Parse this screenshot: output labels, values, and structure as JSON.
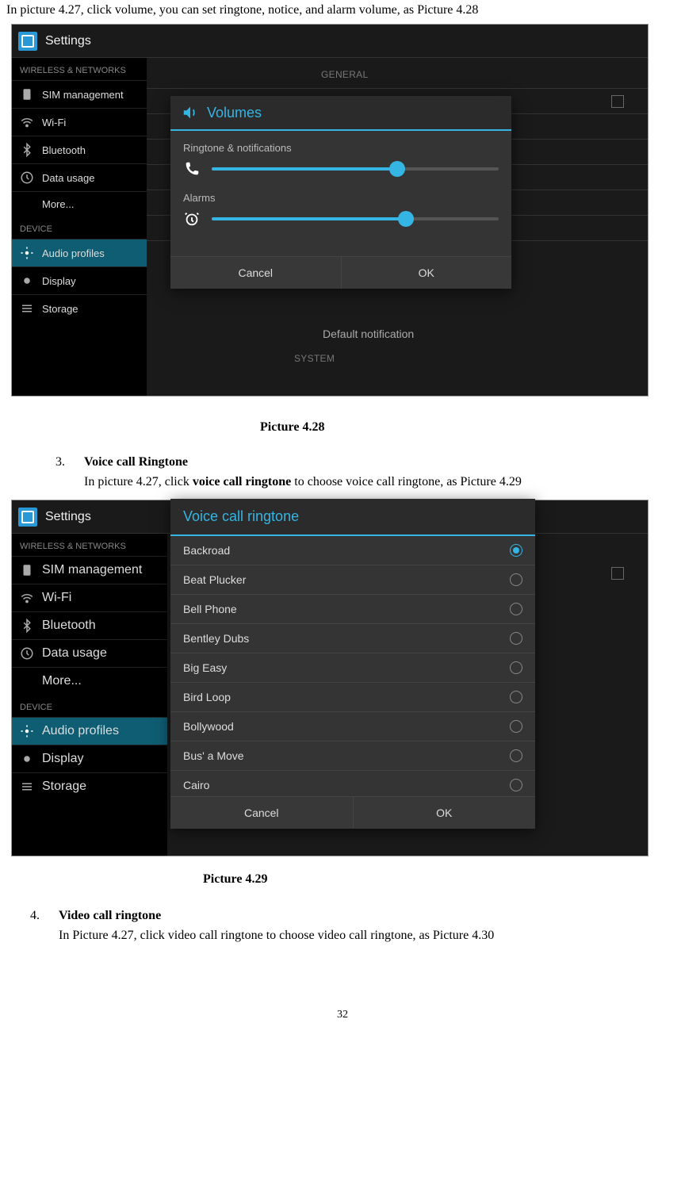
{
  "intro_text": "In picture 4.27, click volume, you can set ringtone, notice, and alarm volume, as Picture 4.28",
  "pic428": {
    "header_title": "Settings",
    "section_wireless": "WIRELESS & NETWORKS",
    "items_wireless": [
      "SIM management",
      "Wi-Fi",
      "Bluetooth",
      "Data usage",
      "More..."
    ],
    "section_device": "DEVICE",
    "items_device": [
      "Audio profiles",
      "Display",
      "Storage"
    ],
    "right_general": "GENERAL",
    "right_default_notification": "Default notification",
    "right_system": "SYSTEM",
    "dialog": {
      "title": "Volumes",
      "label_ringtone": "Ringtone & notifications",
      "label_alarms": "Alarms",
      "cancel": "Cancel",
      "ok": "OK"
    },
    "caption": "Picture 4.28"
  },
  "sec3": {
    "num": "3.",
    "head": "Voice call Ringtone",
    "para_a": "In picture 4.27, click ",
    "para_bold": "voice call ringtone",
    "para_b": " to choose voice call ringtone, as Picture 4.29"
  },
  "pic429": {
    "header_title": "Settings",
    "section_wireless": "WIRELESS & NETWORKS",
    "items_wireless": [
      "SIM management",
      "Wi-Fi",
      "Bluetooth",
      "Data usage",
      "More..."
    ],
    "section_device": "DEVICE",
    "items_device": [
      "Audio profiles",
      "Display",
      "Storage"
    ],
    "dialog": {
      "title": "Voice call ringtone",
      "options": [
        "Backroad",
        "Beat Plucker",
        "Bell Phone",
        "Bentley Dubs",
        "Big Easy",
        "Bird Loop",
        "Bollywood",
        "Bus' a Move",
        "Cairo"
      ],
      "cancel": "Cancel",
      "ok": "OK"
    },
    "caption": "Picture 4.29"
  },
  "sec4": {
    "num": "4.",
    "head": "Video call ringtone",
    "para": "In Picture 4.27, click video call ringtone to choose video call ringtone, as Picture 4.30"
  },
  "page_number": "32"
}
